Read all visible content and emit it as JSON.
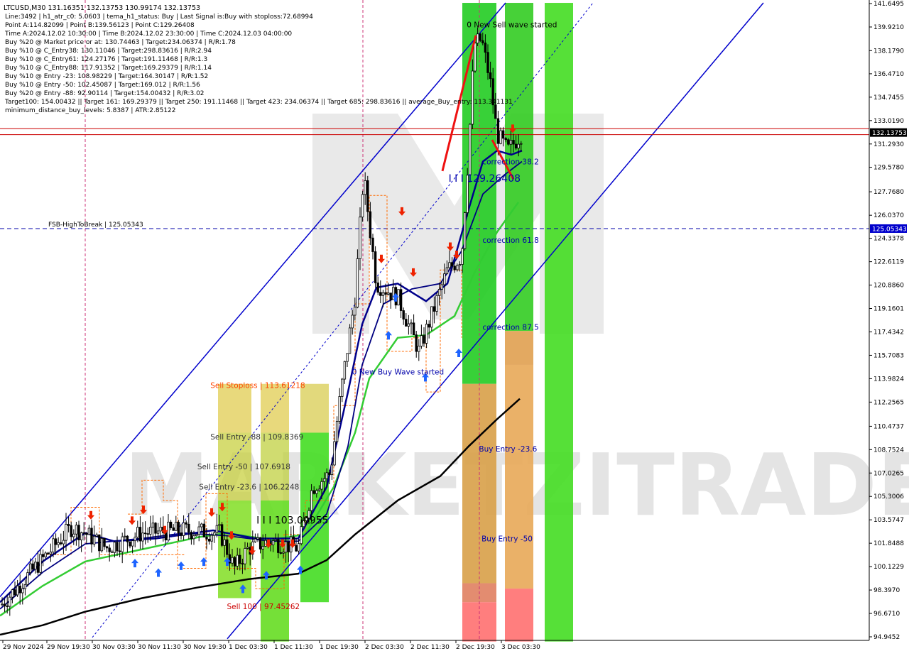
{
  "header": {
    "symbol_line": "LTCUSD,M30  131.16351 132.13753 130.99174 132.13753",
    "lines": [
      "Line:3492 | h1_atr_c0: 5.0603 | tema_h1_status: Buy | Last Signal is:Buy with stoploss:72.68994",
      "Point A:114.82099 | Point B:139.56123 | Point C:129.26408",
      "Time A:2024.12.02 10:30:00 | Time B:2024.12.02 23:30:00 | Time C:2024.12.03 04:00:00",
      "Buy %20 @ Market price or at: 130.74463 | Target:234.06374 | R/R:1.78",
      "Buy %10 @ C_Entry38: 130.11046 | Target:298.83616 | R/R:2.94",
      "Buy %10 @ C_Entry61: 124.27176 | Target:191.11468 | R/R:1.3",
      "Buy %10 @ C_Entry88: 117.91352 | Target:169.29379 | R/R:1.14",
      "Buy %10 @ Entry -23: 108.98229 | Target:164.30147 | R/R:1.52",
      "Buy %10 @ Entry -50: 102.45087 | Target:169.012 | R/R:1.56",
      "Buy %20 @ Entry -88: 92.90114 | Target:154.00432 | R/R:3.02",
      "Target100: 154.00432 || Target 161: 169.29379 || Target 250: 191.11468 || Target 423: 234.06374 || Target 685: 298.83616 || average_Buy_entry: 113.341131",
      "minimum_distance_buy_levels: 5.8387 | ATR:2.85122"
    ]
  },
  "watermark": "MARKETZITRADE",
  "colors": {
    "bull_candle": "#000000",
    "bear_candle": "#000000",
    "channel": "#0000cc",
    "fsb_line": "#0000aa",
    "price_line": "#cc0000",
    "ma_fast": "#00008b",
    "ma_mid": "#000080",
    "ma_green": "#33cc33",
    "ma_slow": "#000000",
    "zone_green": "#22cc22",
    "zone_orange": "#e0a050",
    "zone_red": "#ff6666",
    "buy_arrow": "#1e64ff",
    "sell_arrow": "#ee2200",
    "stoploss_dash": "#ff6a00",
    "current_price_label_bg": "#000000",
    "fsb_label_bg": "#0000cc"
  },
  "chart_data": {
    "type": "candlestick",
    "symbol": "LTCUSD",
    "timeframe": "M30",
    "ylim": [
      94.9452,
      141.6495
    ],
    "y_ticks": [
      "141.6495",
      "139.9210",
      "138.1790",
      "136.4710",
      "134.7455",
      "133.0190",
      "131.2930",
      "129.5780",
      "127.7680",
      "126.0370",
      "124.3378",
      "122.6119",
      "120.8860",
      "119.1601",
      "117.4342",
      "115.7083",
      "113.9824",
      "112.2565",
      "110.4737",
      "108.7524",
      "107.0265",
      "105.3006",
      "103.5747",
      "101.8488",
      "100.1229",
      "98.3970",
      "96.6710",
      "94.9452"
    ],
    "x_ticks": [
      "29 Nov 2024",
      "29 Nov 19:30",
      "30 Nov 03:30",
      "30 Nov 11:30",
      "30 Nov 19:30",
      "1 Dec 03:30",
      "1 Dec 11:30",
      "1 Dec 19:30",
      "2 Dec 03:30",
      "2 Dec 11:30",
      "2 Dec 19:30",
      "3 Dec 03:30"
    ],
    "current_price": "132.13753",
    "current_price_value": 132.13753,
    "red_line_value": 132.42,
    "fsb": {
      "label": "FSB-HighToBreak | 125.05343",
      "value": 125.05343,
      "axis_label": "125.05343"
    },
    "annotations": [
      {
        "text": "0 New Sell wave started",
        "x_frac": 0.537,
        "y": 139.9,
        "color": "#000000"
      },
      {
        "text": "0 New Buy Wave started",
        "x_frac": 0.405,
        "y": 114.3,
        "color": "#0000aa"
      },
      {
        "text": "correction 38.2",
        "x_frac": 0.555,
        "y": 129.8,
        "color": "#0000aa"
      },
      {
        "text": "I I I 129.26408",
        "x_frac": 0.516,
        "y": 128.5,
        "color": "#0000aa",
        "large": true
      },
      {
        "text": "correction 61.8",
        "x_frac": 0.555,
        "y": 124.0,
        "color": "#0000aa"
      },
      {
        "text": "correction 87.5",
        "x_frac": 0.555,
        "y": 117.6,
        "color": "#0000aa"
      },
      {
        "text": "Buy Entry -23.6",
        "x_frac": 0.551,
        "y": 108.6,
        "color": "#0000aa"
      },
      {
        "text": "Buy Entry -50",
        "x_frac": 0.554,
        "y": 102.0,
        "color": "#0000aa"
      },
      {
        "text": "Sell Stoploss | 113.61218",
        "x_frac": 0.242,
        "y": 113.3,
        "color": "#ff4400"
      },
      {
        "text": "Sell Entry -88 | 109.8369",
        "x_frac": 0.242,
        "y": 109.5,
        "color": "#333333"
      },
      {
        "text": "Sell Entry -50 | 107.6918",
        "x_frac": 0.227,
        "y": 107.3,
        "color": "#333333"
      },
      {
        "text": "Sell Entry -23.6 | 106.2248",
        "x_frac": 0.229,
        "y": 105.8,
        "color": "#333333"
      },
      {
        "text": "I I I 103.00955",
        "x_frac": 0.295,
        "y": 103.3,
        "color": "#000000",
        "large": true
      },
      {
        "text": "Sell 100 | 97.45262",
        "x_frac": 0.261,
        "y": 97.0,
        "color": "#cc0000"
      }
    ]
  }
}
